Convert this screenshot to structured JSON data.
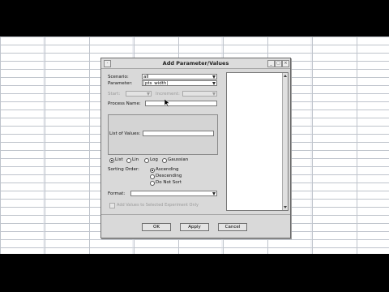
{
  "dialog": {
    "title": "Add Parameter/Values",
    "scenario_label": "Scenario:",
    "scenario_value": "all",
    "parameter_label": "Parameter:",
    "parameter_value": "pts_width",
    "start_label": "Start:",
    "increment_label": "Increment:",
    "process_name_label": "Process Name:",
    "process_name_value": "",
    "list_of_values_label": "List of Values:",
    "distribution_options": [
      "List",
      "Lin",
      "Log",
      "Gaussian"
    ],
    "distribution_selected": "List",
    "sorting_order_label": "Sorting Order:",
    "sorting_options": [
      "Ascending",
      "Descending",
      "Do Not Sort"
    ],
    "sorting_selected": "Ascending",
    "format_label": "Format:",
    "format_value": "",
    "checkbox_label": "Add Values to Selected Experiment Only",
    "buttons": {
      "ok": "OK",
      "apply": "Apply",
      "cancel": "Cancel"
    }
  }
}
